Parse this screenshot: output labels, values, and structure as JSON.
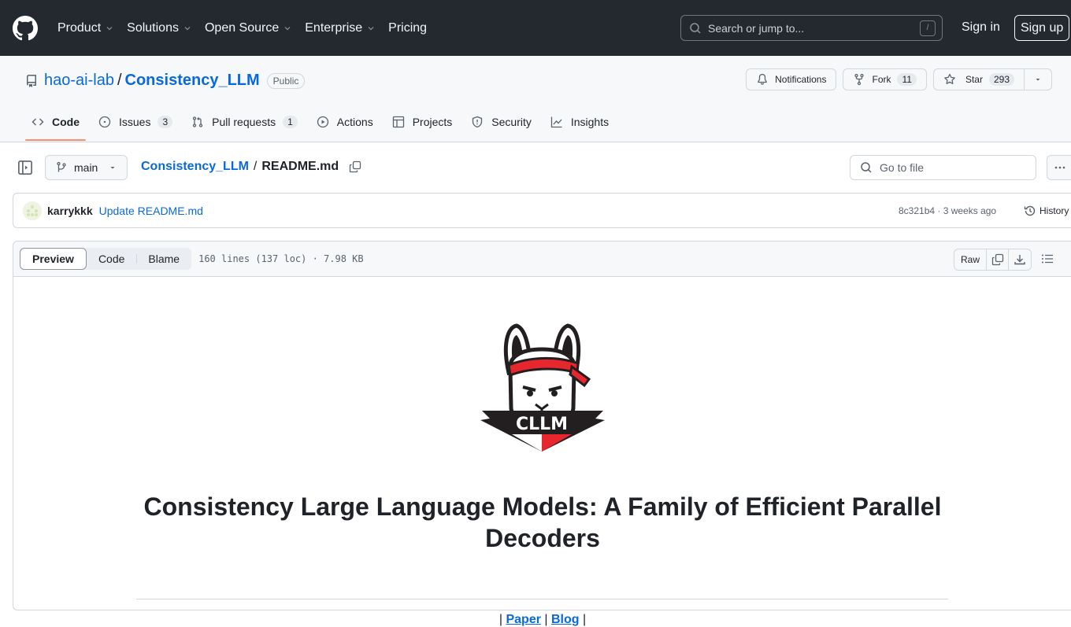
{
  "header": {
    "nav": [
      {
        "label": "Product",
        "has_dropdown": true
      },
      {
        "label": "Solutions",
        "has_dropdown": true
      },
      {
        "label": "Open Source",
        "has_dropdown": true
      },
      {
        "label": "Enterprise",
        "has_dropdown": true
      },
      {
        "label": "Pricing",
        "has_dropdown": false
      }
    ],
    "search_placeholder": "Search or jump to...",
    "search_shortcut": "/",
    "sign_in": "Sign in",
    "sign_up": "Sign up"
  },
  "repo": {
    "owner": "hao-ai-lab",
    "separator": "/",
    "name": "Consistency_LLM",
    "visibility": "Public",
    "notifications_label": "Notifications",
    "fork_label": "Fork",
    "fork_count": "11",
    "star_label": "Star",
    "star_count": "293",
    "tabs": [
      {
        "label": "Code",
        "icon": "code-icon",
        "active": true,
        "count": null
      },
      {
        "label": "Issues",
        "icon": "issue-opened-icon",
        "active": false,
        "count": "3"
      },
      {
        "label": "Pull requests",
        "icon": "git-pull-request-icon",
        "active": false,
        "count": "1"
      },
      {
        "label": "Actions",
        "icon": "play-icon",
        "active": false,
        "count": null
      },
      {
        "label": "Projects",
        "icon": "table-icon",
        "active": false,
        "count": null
      },
      {
        "label": "Security",
        "icon": "shield-icon",
        "active": false,
        "count": null
      },
      {
        "label": "Insights",
        "icon": "graph-icon",
        "active": false,
        "count": null
      }
    ]
  },
  "file_nav": {
    "branch": "main",
    "breadcrumb_repo": "Consistency_LLM",
    "breadcrumb_sep": "/",
    "file_name": "README.md",
    "goto_placeholder": "Go to file"
  },
  "commit": {
    "author": "karrykkk",
    "message": "Update README.md",
    "sha": "8c321b4",
    "time": "3 weeks ago",
    "meta": "8c321b4 · 3 weeks ago",
    "history_label": "History"
  },
  "file_toolbar": {
    "views": [
      "Preview",
      "Code",
      "Blame"
    ],
    "active_view": "Preview",
    "info": "160 lines (137 loc) · 7.98 KB",
    "raw_label": "Raw"
  },
  "readme": {
    "logo_text": "CLLM",
    "title": "Consistency Large Language Models: A Family of Efficient Parallel Decoders",
    "links_prefix": "| ",
    "links": [
      {
        "label": "Paper"
      },
      {
        "label": "Blog"
      }
    ],
    "link_sep": " | ",
    "links_suffix": " |"
  },
  "colors": {
    "header_bg": "#24292f",
    "link": "#0969da",
    "tab_underline": "#fd8c73",
    "logo_red": "#e8262e",
    "logo_dark": "#231f20"
  }
}
